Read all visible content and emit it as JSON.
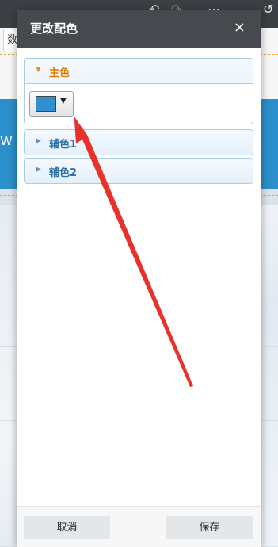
{
  "background": {
    "tab_text": "数",
    "banner_text": "W"
  },
  "dialog": {
    "title": "更改配色",
    "close_icon": "×",
    "sections": [
      {
        "label": "主色",
        "expanded": true,
        "color": "#2f8fd0"
      },
      {
        "label": "辅色1",
        "expanded": false
      },
      {
        "label": "辅色2",
        "expanded": false
      }
    ],
    "footer": {
      "cancel_label": "取消",
      "save_label": "保存"
    }
  },
  "colors": {
    "accent": "#e07b00",
    "header": "#46494e",
    "annotation": "#e8312a"
  }
}
